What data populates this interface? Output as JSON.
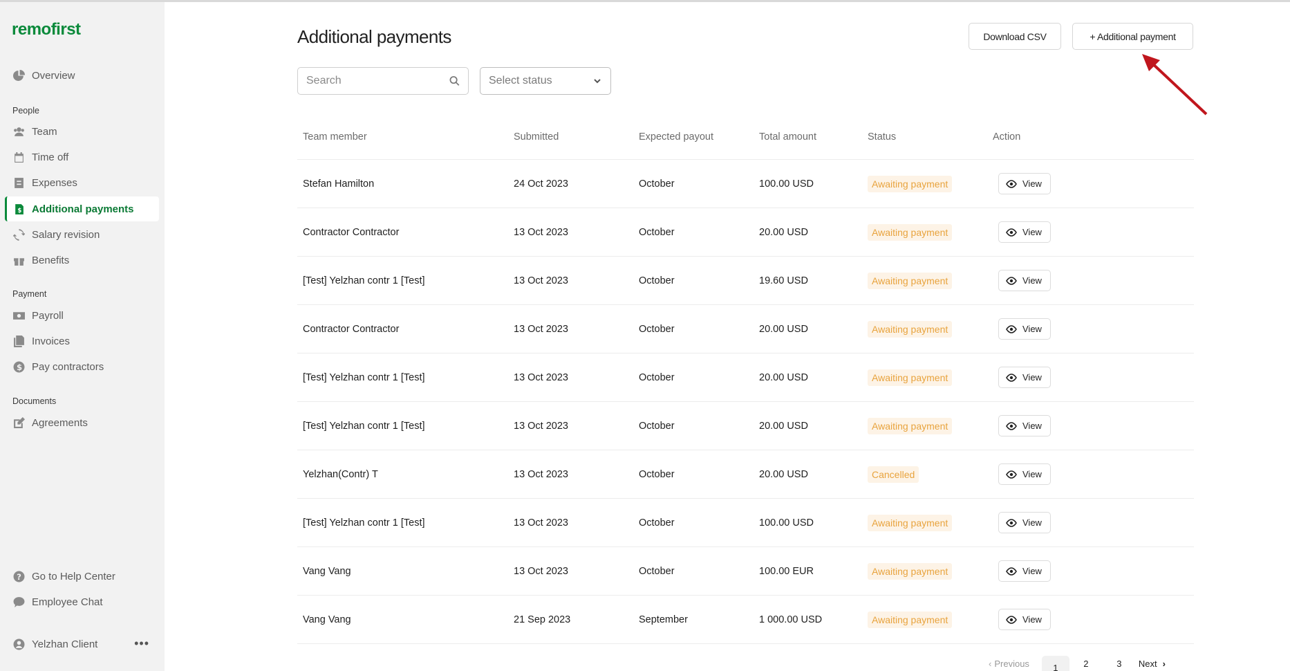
{
  "app": {
    "logo": "remofirst"
  },
  "sidebar": {
    "overview": "Overview",
    "sections": {
      "people": "People",
      "payment": "Payment",
      "documents": "Documents"
    },
    "people_items": [
      "Team",
      "Time off",
      "Expenses",
      "Additional payments",
      "Salary revision",
      "Benefits"
    ],
    "payment_items": [
      "Payroll",
      "Invoices",
      "Pay contractors"
    ],
    "documents_items": [
      "Agreements"
    ],
    "help": "Go to Help Center",
    "chat": "Employee Chat",
    "user": "Yelzhan Client",
    "more": "•••"
  },
  "page": {
    "title": "Additional payments",
    "download_csv": "Download CSV",
    "add_payment": "+ Additional payment"
  },
  "filters": {
    "search_placeholder": "Search",
    "status_placeholder": "Select status"
  },
  "table": {
    "headers": [
      "Team member",
      "Submitted",
      "Expected payout",
      "Total amount",
      "Status",
      "Action"
    ],
    "view_label": "View",
    "rows": [
      {
        "member": "Stefan Hamilton",
        "submitted": "24 Oct 2023",
        "payout": "October",
        "amount": "100.00 USD",
        "status": "Awaiting payment"
      },
      {
        "member": "Contractor Contractor",
        "submitted": "13 Oct 2023",
        "payout": "October",
        "amount": "20.00 USD",
        "status": "Awaiting payment"
      },
      {
        "member": "[Test] Yelzhan contr 1 [Test]",
        "submitted": "13 Oct 2023",
        "payout": "October",
        "amount": "19.60 USD",
        "status": "Awaiting payment"
      },
      {
        "member": "Contractor Contractor",
        "submitted": "13 Oct 2023",
        "payout": "October",
        "amount": "20.00 USD",
        "status": "Awaiting payment"
      },
      {
        "member": "[Test] Yelzhan contr 1 [Test]",
        "submitted": "13 Oct 2023",
        "payout": "October",
        "amount": "20.00 USD",
        "status": "Awaiting payment"
      },
      {
        "member": "[Test] Yelzhan contr 1 [Test]",
        "submitted": "13 Oct 2023",
        "payout": "October",
        "amount": "20.00 USD",
        "status": "Awaiting payment"
      },
      {
        "member": "Yelzhan(Contr) T",
        "submitted": "13 Oct 2023",
        "payout": "October",
        "amount": "20.00 USD",
        "status": "Cancelled"
      },
      {
        "member": "[Test] Yelzhan contr 1 [Test]",
        "submitted": "13 Oct 2023",
        "payout": "October",
        "amount": "100.00 USD",
        "status": "Awaiting payment"
      },
      {
        "member": "Vang Vang",
        "submitted": "13 Oct 2023",
        "payout": "October",
        "amount": "100.00 EUR",
        "status": "Awaiting payment"
      },
      {
        "member": "Vang Vang",
        "submitted": "21 Sep 2023",
        "payout": "September",
        "amount": "1 000.00 USD",
        "status": "Awaiting payment"
      }
    ]
  },
  "pagination": {
    "previous": "Previous",
    "pages": [
      "1",
      "2",
      "3"
    ],
    "current": "1",
    "next": "Next"
  },
  "colors": {
    "brand": "#0b8a3b",
    "status_text": "#e8a33d",
    "status_bg": "#fdf3e6",
    "annotation_arrow": "#c0161d"
  },
  "icons": {
    "overview": "pie-chart-icon",
    "team": "users-icon",
    "time_off": "calendar-icon",
    "expenses": "receipt-icon",
    "additional_payments": "money-doc-icon",
    "salary_revision": "refresh-icon",
    "benefits": "gift-icon",
    "payroll": "banknote-icon",
    "invoices": "files-icon",
    "pay_contractors": "dollar-circle-icon",
    "agreements": "edit-icon",
    "help": "question-circle-icon",
    "chat": "chat-bubble-icon",
    "user": "user-circle-icon",
    "search": "search-icon",
    "select": "chevron-down-icon",
    "view": "eye-icon"
  }
}
